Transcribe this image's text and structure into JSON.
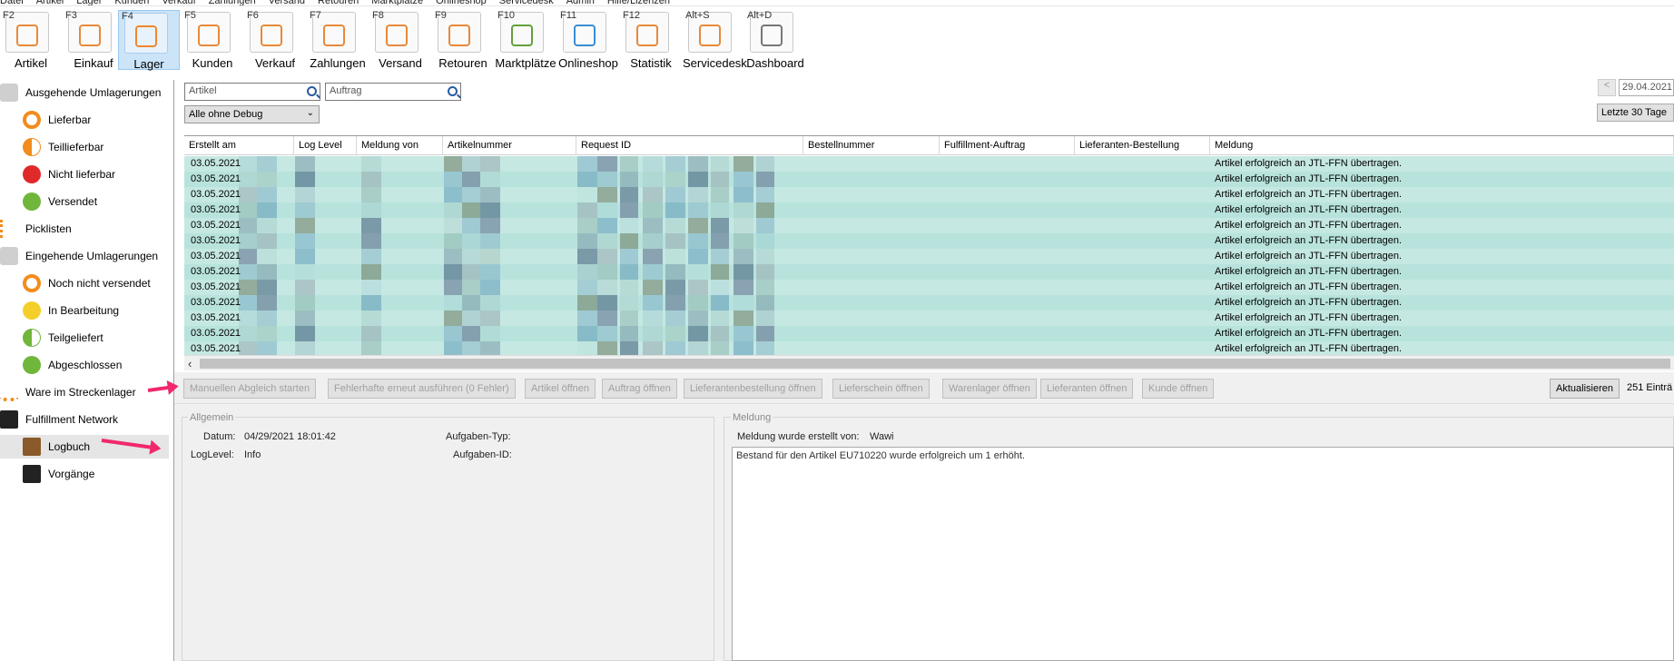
{
  "menubar": [
    "Datei",
    "Artikel",
    "Lager",
    "Kunden",
    "Verkauf",
    "Zahlungen",
    "Versand",
    "Retouren",
    "Marktplätze",
    "Onlineshop",
    "Servicedesk",
    "Admin",
    "Hilfe/Lizenzen"
  ],
  "ribbon": [
    {
      "key": "F2",
      "label": "Artikel",
      "icon": "article-icon",
      "color": "#e8893a"
    },
    {
      "key": "F3",
      "label": "Einkauf",
      "icon": "purchase-icon",
      "color": "#e8893a"
    },
    {
      "key": "F4",
      "label": "Lager",
      "icon": "warehouse-icon",
      "color": "#f0872f",
      "active": true
    },
    {
      "key": "F5",
      "label": "Kunden",
      "icon": "customers-icon",
      "color": "#e8893a"
    },
    {
      "key": "F6",
      "label": "Verkauf",
      "icon": "sales-icon",
      "color": "#e8893a"
    },
    {
      "key": "F7",
      "label": "Zahlungen",
      "icon": "payments-icon",
      "color": "#e8893a"
    },
    {
      "key": "F8",
      "label": "Versand",
      "icon": "shipping-icon",
      "color": "#e8893a"
    },
    {
      "key": "F9",
      "label": "Retouren",
      "icon": "returns-icon",
      "color": "#e8893a"
    },
    {
      "key": "F10",
      "label": "Marktplätze",
      "icon": "marketplaces-icon",
      "color": "#62a13b"
    },
    {
      "key": "F11",
      "label": "Onlineshop",
      "icon": "onlineshop-icon",
      "color": "#3a8ed6"
    },
    {
      "key": "F12",
      "label": "Statistik",
      "icon": "statistics-icon",
      "color": "#e8893a"
    },
    {
      "key": "Alt+S",
      "label": "Servicedesk",
      "icon": "servicedesk-icon",
      "color": "#e8893a"
    },
    {
      "key": "Alt+D",
      "label": "Dashboard",
      "icon": "dashboard-icon",
      "color": "#777777"
    }
  ],
  "sidebar": [
    {
      "label": "Ausgehende Umlagerungen",
      "icon": "outgoing-transfer-icon",
      "level": 0
    },
    {
      "label": "Lieferbar",
      "icon": "circle-orange-icon",
      "level": 1
    },
    {
      "label": "Teillieferbar",
      "icon": "half-circle-orange-icon",
      "level": 1
    },
    {
      "label": "Nicht lieferbar",
      "icon": "cross-red-icon",
      "level": 1
    },
    {
      "label": "Versendet",
      "icon": "check-green-icon",
      "level": 1
    },
    {
      "label": "Picklisten",
      "icon": "list-icon",
      "level": 0
    },
    {
      "label": "Eingehende Umlagerungen",
      "icon": "incoming-transfer-icon",
      "level": 0
    },
    {
      "label": "Noch nicht versendet",
      "icon": "circle-orange-icon",
      "level": 1
    },
    {
      "label": "In Bearbeitung",
      "icon": "dots-yellow-icon",
      "level": 1
    },
    {
      "label": "Teilgeliefert",
      "icon": "half-circle-green-icon",
      "level": 1
    },
    {
      "label": "Abgeschlossen",
      "icon": "check-green-icon",
      "level": 1
    },
    {
      "label": "Ware im Streckenlager",
      "icon": "truck-icon",
      "level": 0
    },
    {
      "label": "Fulfillment Network",
      "icon": "jtl-icon",
      "level": 0
    },
    {
      "label": "Logbuch",
      "icon": "logbook-icon",
      "level": 1,
      "selected": true
    },
    {
      "label": "Vorgänge",
      "icon": "jtl-icon",
      "level": 1
    }
  ],
  "filters": {
    "artikel_placeholder": "Artikel",
    "auftrag_placeholder": "Auftrag",
    "level_select": "Alle ohne Debug",
    "date": "29.04.2021",
    "range": "Letzte 30 Tage"
  },
  "grid": {
    "columns": [
      "Erstellt am",
      "Log Level",
      "Meldung von",
      "Artikelnummer",
      "Request ID",
      "Bestellnummer",
      "Fulfillment-Auftrag",
      "Lieferanten-Bestellung",
      "Meldung"
    ],
    "rows": [
      {
        "date": "03.05.2021",
        "message": "Artikel erfolgreich an JTL-FFN übertragen."
      },
      {
        "date": "03.05.2021",
        "message": "Artikel erfolgreich an JTL-FFN übertragen."
      },
      {
        "date": "03.05.2021",
        "message": "Artikel erfolgreich an JTL-FFN übertragen."
      },
      {
        "date": "03.05.2021",
        "message": "Artikel erfolgreich an JTL-FFN übertragen."
      },
      {
        "date": "03.05.2021",
        "message": "Artikel erfolgreich an JTL-FFN übertragen."
      },
      {
        "date": "03.05.2021",
        "message": "Artikel erfolgreich an JTL-FFN übertragen."
      },
      {
        "date": "03.05.2021",
        "message": "Artikel erfolgreich an JTL-FFN übertragen."
      },
      {
        "date": "03.05.2021",
        "message": "Artikel erfolgreich an JTL-FFN übertragen."
      },
      {
        "date": "03.05.2021",
        "message": "Artikel erfolgreich an JTL-FFN übertragen."
      },
      {
        "date": "03.05.2021",
        "message": "Artikel erfolgreich an JTL-FFN übertragen."
      },
      {
        "date": "03.05.2021",
        "message": "Artikel erfolgreich an JTL-FFN übertragen."
      },
      {
        "date": "03.05.2021",
        "message": "Artikel erfolgreich an JTL-FFN übertragen."
      },
      {
        "date": "03.05.2021",
        "message": "Artikel erfolgreich an JTL-FFN übertragen."
      }
    ]
  },
  "actions": [
    {
      "label": "Manuellen Abgleich starten",
      "enabled": false
    },
    {
      "label": "Fehlerhafte erneut ausführen (0 Fehler)",
      "enabled": false
    },
    {
      "label": "Artikel öffnen",
      "enabled": false
    },
    {
      "label": "Auftrag öffnen",
      "enabled": false
    },
    {
      "label": "Lieferantenbestellung öffnen",
      "enabled": false
    },
    {
      "label": "Lieferschein öffnen",
      "enabled": false
    },
    {
      "label": "Warenlager öffnen",
      "enabled": false
    },
    {
      "label": "Lieferanten öffnen",
      "enabled": false
    },
    {
      "label": "Kunde öffnen",
      "enabled": false
    }
  ],
  "refresh_label": "Aktualisieren",
  "entry_count": "251 Einträ",
  "details": {
    "group_general": "Allgemein",
    "datum_label": "Datum:",
    "datum_value": "04/29/2021 18:01:42",
    "loglevel_label": "LogLevel:",
    "loglevel_value": "Info",
    "aufgabentyp_label": "Aufgaben-Typ:",
    "aufgabenid_label": "Aufgaben-ID:",
    "group_message": "Meldung",
    "created_by_label": "Meldung wurde erstellt von:",
    "created_by_value": "Wawi",
    "message_text": "Bestand für den Artikel EU710220 wurde erfolgreich um 1 erhöht."
  }
}
